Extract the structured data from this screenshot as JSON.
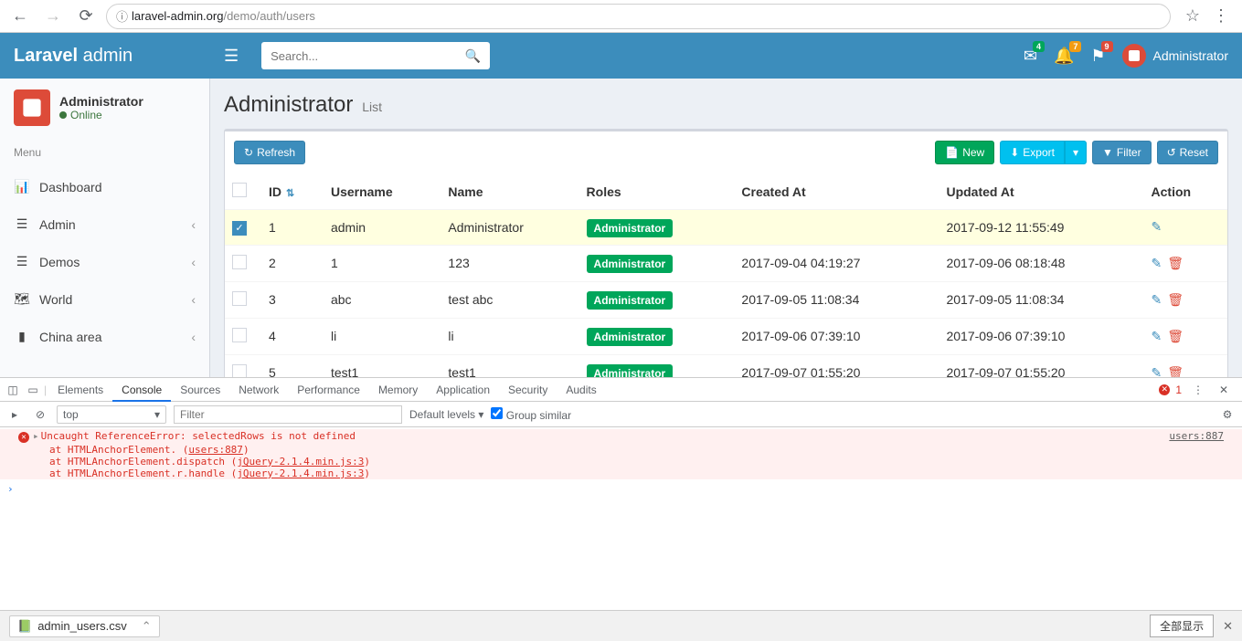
{
  "browser": {
    "url_info_icon": "ⓘ",
    "url_host": "laravel-admin.org",
    "url_path": "/demo/auth/users"
  },
  "header": {
    "logo_bold": "Laravel",
    "logo_light": " admin",
    "search_placeholder": "Search...",
    "badges": {
      "mail": "4",
      "bell": "7",
      "flag": "9"
    },
    "user_name": "Administrator"
  },
  "sidebar": {
    "user_name": "Administrator",
    "user_status": "Online",
    "menu_header": "Menu",
    "items": [
      {
        "icon": "bar-chart",
        "label": "Dashboard",
        "caret": false
      },
      {
        "icon": "list",
        "label": "Admin",
        "caret": true
      },
      {
        "icon": "list",
        "label": "Demos",
        "caret": true
      },
      {
        "icon": "map",
        "label": "World",
        "caret": true
      },
      {
        "icon": "map-solid",
        "label": "China area",
        "caret": true
      }
    ]
  },
  "page": {
    "title": "Administrator",
    "subtitle": "List"
  },
  "toolbar": {
    "refresh": "Refresh",
    "new": "New",
    "export": "Export",
    "filter": "Filter",
    "reset": "Reset"
  },
  "table": {
    "columns": [
      "ID",
      "Username",
      "Name",
      "Roles",
      "Created At",
      "Updated At",
      "Action"
    ],
    "rows": [
      {
        "checked": true,
        "id": "1",
        "username": "admin",
        "name": "Administrator",
        "role": "Administrator",
        "created": "",
        "updated": "2017-09-12 11:55:49",
        "del": false
      },
      {
        "checked": false,
        "id": "2",
        "username": "1",
        "name": "123",
        "role": "Administrator",
        "created": "2017-09-04 04:19:27",
        "updated": "2017-09-06 08:18:48",
        "del": true
      },
      {
        "checked": false,
        "id": "3",
        "username": "abc",
        "name": "test abc",
        "role": "Administrator",
        "created": "2017-09-05 11:08:34",
        "updated": "2017-09-05 11:08:34",
        "del": true
      },
      {
        "checked": false,
        "id": "4",
        "username": "li",
        "name": "li",
        "role": "Administrator",
        "created": "2017-09-06 07:39:10",
        "updated": "2017-09-06 07:39:10",
        "del": true
      },
      {
        "checked": false,
        "id": "5",
        "username": "test1",
        "name": "test1",
        "role": "Administrator",
        "created": "2017-09-07 01:55:20",
        "updated": "2017-09-07 01:55:20",
        "del": true
      }
    ]
  },
  "devtools": {
    "tabs": [
      "Elements",
      "Console",
      "Sources",
      "Network",
      "Performance",
      "Memory",
      "Application",
      "Security",
      "Audits"
    ],
    "active_tab": "Console",
    "err_count": "1",
    "context": "top",
    "filter_placeholder": "Filter",
    "levels": "Default levels",
    "group_similar": "Group similar",
    "error": {
      "msg": "Uncaught ReferenceError: selectedRows is not defined",
      "src": "users:887",
      "stack": [
        "at HTMLAnchorElement.<anonymous> (users:887)",
        "at HTMLAnchorElement.dispatch (jQuery-2.1.4.min.js:3)",
        "at HTMLAnchorElement.r.handle (jQuery-2.1.4.min.js:3)"
      ]
    }
  },
  "download": {
    "file": "admin_users.csv",
    "showall": "全部显示"
  }
}
